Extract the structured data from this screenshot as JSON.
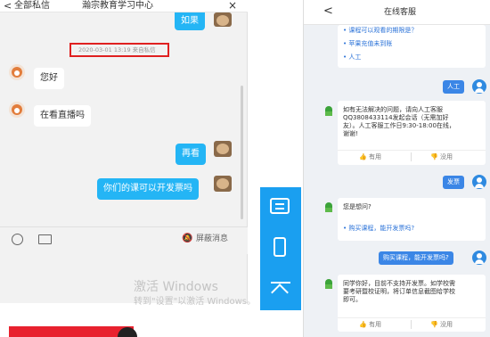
{
  "left": {
    "back_glyph": "<",
    "back_label": "全部私信",
    "title": "瀚宗教育学习中心",
    "close_glyph": "×",
    "top_bubble": "如果",
    "timestamp": "2020-03-01 13:19 来自私信",
    "messages": [
      {
        "side": "left",
        "text": "您好"
      },
      {
        "side": "left",
        "text": "在看直播吗"
      },
      {
        "side": "right",
        "text": "再看"
      },
      {
        "side": "right",
        "text": "你们的课可以开发票吗"
      }
    ],
    "mute_label": "屏蔽消息",
    "watermark_title": "激活 Windows",
    "watermark_sub": "转到\"设置\"以激活 Windows。"
  },
  "right": {
    "back_glyph": "<",
    "title": "在线客服",
    "links_top": [
      "课程可以观看的期限是？",
      "苹果充值未到账",
      "人工"
    ],
    "user_msgs": [
      "人工",
      "发票",
      "购买课程，能开发票吗?"
    ],
    "bot_reply_1": "如有无法解决的问题，请向人工客服QQ3808433114发起会话（无需加好友）。人工客服工作日9:30-18:00在线，谢谢!",
    "feedback_yes": "有用",
    "feedback_no": "没用",
    "bot_q_2": "您是想问?",
    "bot_link_2": "购买课程，能开发票吗?",
    "bot_reply_3": "同学你好，目前不支持开发票。如学校需要考研暨校证明，将订单信息截图给学校即可。"
  },
  "colors": {
    "accent_blue": "#24b5f5",
    "nav_blue": "#1a9ff0",
    "highlight_red": "#e02020",
    "user_bubble": "#3b86e6",
    "link_blue": "#2a72d8"
  }
}
